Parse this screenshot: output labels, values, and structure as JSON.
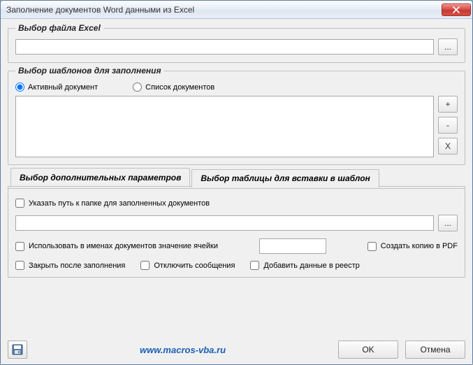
{
  "window": {
    "title": "Заполнение документов Word данными из Excel"
  },
  "excel": {
    "legend": "Выбор файла Excel",
    "path": "",
    "browse_label": "..."
  },
  "templates": {
    "legend": "Выбор шаблонов для заполнения",
    "radio_active": "Активный документ",
    "radio_list": "Список документов",
    "selected_mode": "active",
    "add_label": "+",
    "remove_label": "-",
    "clear_label": "X"
  },
  "tabs": {
    "params": "Выбор дополнительных параметров",
    "table": "Выбор таблицы для вставки в шаблон"
  },
  "params": {
    "output_path_label": "Указать путь к папке для заполненных документов",
    "output_path": "",
    "browse_label": "...",
    "use_cell_label": "Использовать в именах документов значение ячейки",
    "cell_value": "",
    "pdf_label": "Создать копию в PDF",
    "close_label": "Закрыть после заполнения",
    "mute_label": "Отключить сообщения",
    "registry_label": "Добавить данные в реестр"
  },
  "footer": {
    "url": "www.macros-vba.ru",
    "ok": "OK",
    "cancel": "Отмена"
  }
}
